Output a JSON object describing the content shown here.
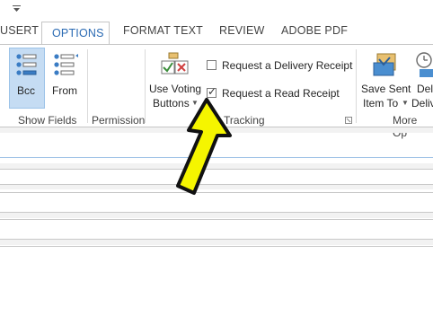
{
  "tabs": {
    "items": [
      {
        "label": "USERT"
      },
      {
        "label": "OPTIONS"
      },
      {
        "label": "FORMAT TEXT"
      },
      {
        "label": "REVIEW"
      },
      {
        "label": "ADOBE PDF"
      }
    ]
  },
  "ribbon": {
    "show_fields": {
      "bcc_label": "Bcc",
      "from_label": "From",
      "group_label": "Show Fields"
    },
    "permission": {
      "group_label": "Permission"
    },
    "tracking": {
      "voting_line1": "Use Voting",
      "voting_line2": "Buttons",
      "delivery_receipt": "Request a Delivery Receipt",
      "read_receipt": "Request a Read Receipt",
      "group_label": "Tracking"
    },
    "more_options": {
      "save_sent_line1": "Save Sent",
      "save_sent_line2": "Item To",
      "delay_line1": "Del",
      "delay_line2": "Deliv",
      "group_label": "More Op"
    }
  },
  "colors": {
    "accent_blue": "#2a6ab3",
    "arrow_fill": "#f5f500",
    "selected_bg": "#c5dcf3"
  },
  "icons": [
    "bcc-icon",
    "from-icon",
    "voting-buttons-icon",
    "save-sent-item-icon",
    "delay-delivery-icon",
    "dialog-launcher-icon",
    "yellow-arrow"
  ]
}
